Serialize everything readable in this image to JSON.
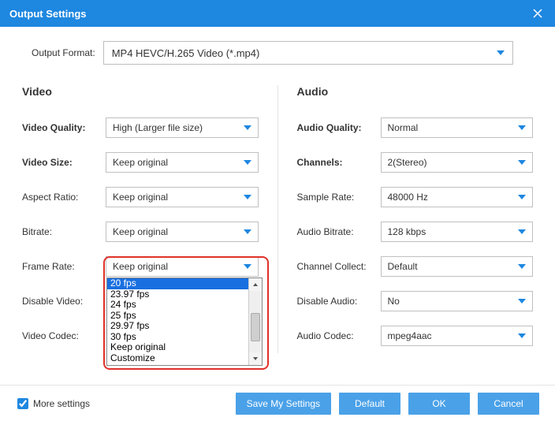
{
  "title": "Output Settings",
  "format": {
    "label": "Output Format:",
    "value": "MP4 HEVC/H.265 Video (*.mp4)"
  },
  "video": {
    "heading": "Video",
    "quality": {
      "label": "Video Quality:",
      "value": "High (Larger file size)"
    },
    "size": {
      "label": "Video Size:",
      "value": "Keep original"
    },
    "aspect": {
      "label": "Aspect Ratio:",
      "value": "Keep original"
    },
    "bitrate": {
      "label": "Bitrate:",
      "value": "Keep original"
    },
    "framerate": {
      "label": "Frame Rate:",
      "value": "Keep original"
    },
    "disable": {
      "label": "Disable Video:",
      "value": ""
    },
    "codec": {
      "label": "Video Codec:",
      "value": ""
    },
    "framerate_options": [
      "20 fps",
      "23.97 fps",
      "24 fps",
      "25 fps",
      "29.97 fps",
      "30 fps",
      "Keep original",
      "Customize"
    ],
    "framerate_selected_index": 0
  },
  "audio": {
    "heading": "Audio",
    "quality": {
      "label": "Audio Quality:",
      "value": "Normal"
    },
    "channels": {
      "label": "Channels:",
      "value": "2(Stereo)"
    },
    "sample": {
      "label": "Sample Rate:",
      "value": "48000 Hz"
    },
    "bitrate": {
      "label": "Audio Bitrate:",
      "value": "128 kbps"
    },
    "collect": {
      "label": "Channel Collect:",
      "value": "Default"
    },
    "disable": {
      "label": "Disable Audio:",
      "value": "No"
    },
    "codec": {
      "label": "Audio Codec:",
      "value": "mpeg4aac"
    }
  },
  "footer": {
    "more": "More settings",
    "save": "Save My Settings",
    "default": "Default",
    "ok": "OK",
    "cancel": "Cancel"
  }
}
